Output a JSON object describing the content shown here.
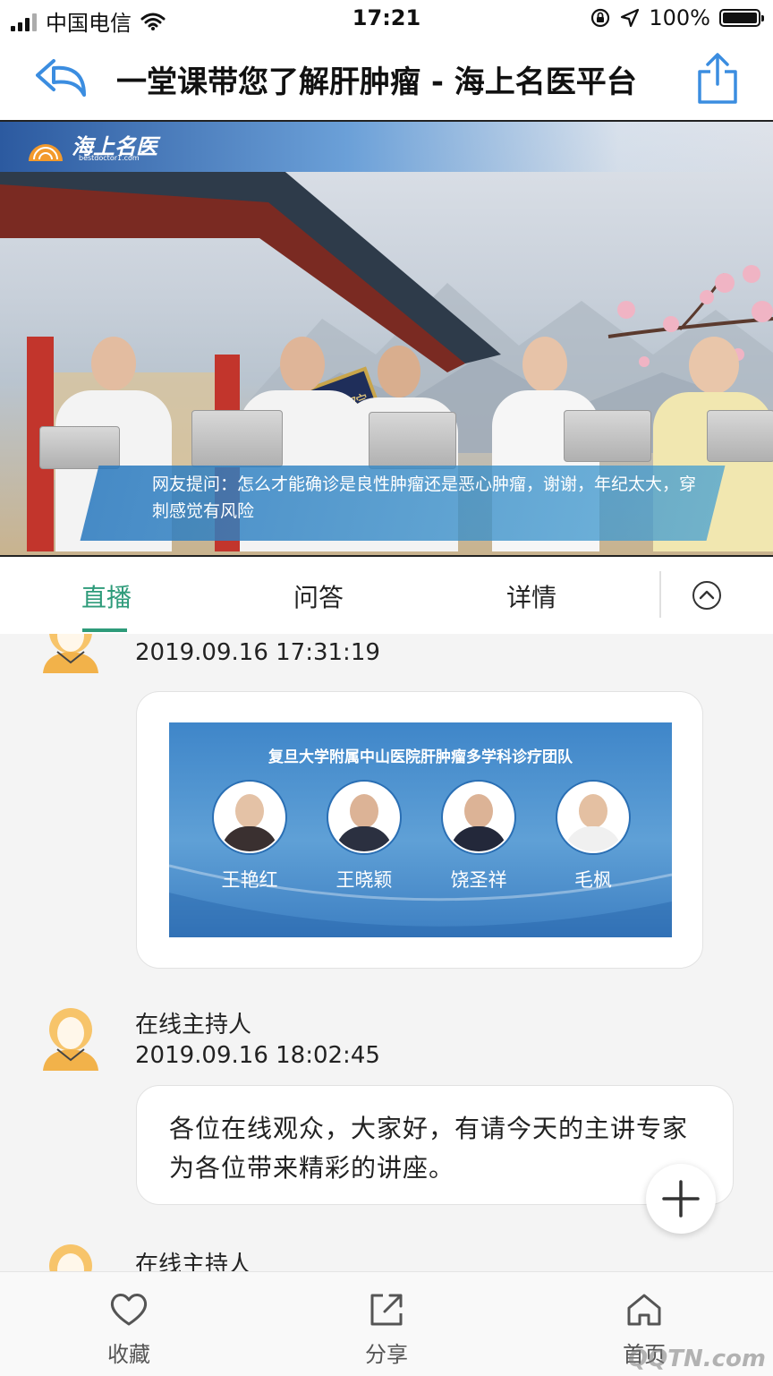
{
  "status_bar": {
    "carrier": "中国电信",
    "time": "17:21",
    "battery": "100%",
    "battery_level": 1.0
  },
  "nav": {
    "title": "一堂课带您了解肝肿瘤 - 海上名医平台",
    "back_icon": "back-arrow-icon",
    "share_icon": "share-upload-icon"
  },
  "video": {
    "logo_text": "海上名医",
    "logo_subtext": "bestdoctor1.com",
    "plaque_text": "中山医院",
    "caption": "网友提问：怎么才能确诊是良性肿瘤还是恶心肿瘤，谢谢，年纪太大，穿刺感觉有风险"
  },
  "tabs": [
    {
      "label": "直播",
      "active": true
    },
    {
      "label": "问答",
      "active": false
    },
    {
      "label": "详情",
      "active": false
    }
  ],
  "feed": {
    "messages": [
      {
        "timestamp": "2019.09.16 17:31:19",
        "card": {
          "title": "复旦大学附属中山医院肝肿瘤多学科诊疗团队",
          "doctors": [
            "王艳红",
            "王晓颖",
            "饶圣祥",
            "毛枫"
          ]
        }
      },
      {
        "author": "在线主持人",
        "timestamp": "2019.09.16 18:02:45",
        "text": "各位在线观众，大家好，有请今天的主讲专家为各位带来精彩的讲座。"
      },
      {
        "author": "在线主持人"
      }
    ]
  },
  "bottom_bar": {
    "items": [
      {
        "label": "收藏",
        "icon": "heart-icon"
      },
      {
        "label": "分享",
        "icon": "share-external-icon"
      },
      {
        "label": "首页",
        "icon": "home-icon"
      }
    ]
  },
  "watermark": "QQTN.com",
  "colors": {
    "accent": "#2e9b7a",
    "nav_icon": "#3b8de0",
    "card_blue": "#4a8fd0",
    "avatar": "#f2b24a"
  }
}
